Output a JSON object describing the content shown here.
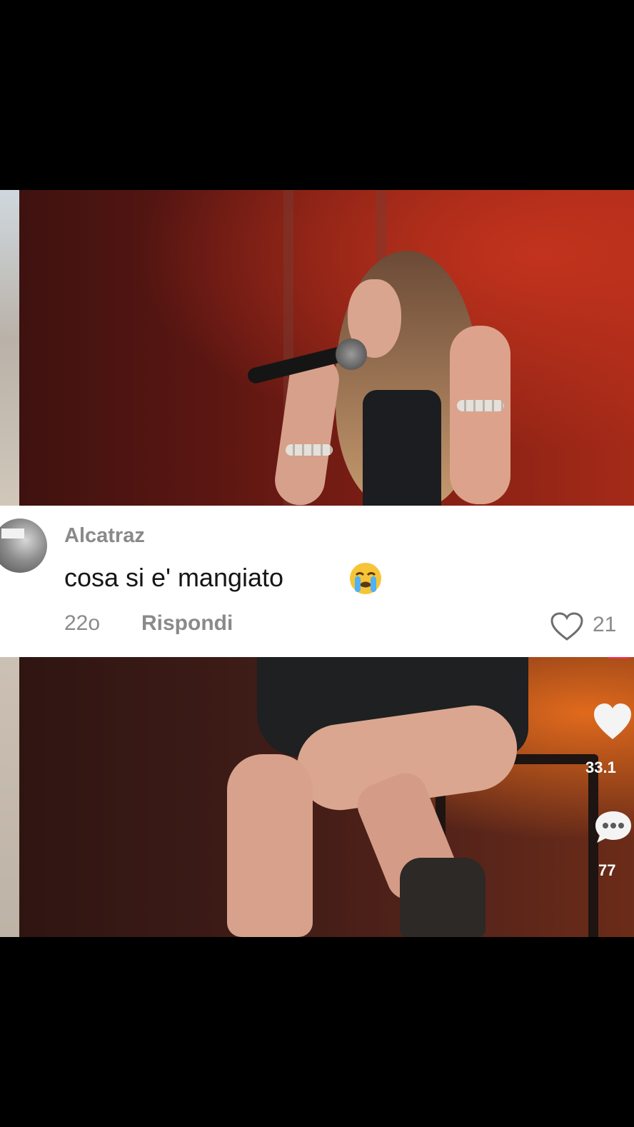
{
  "comment": {
    "username": "Alcatraz",
    "text": "cosa si e' mangiato",
    "emoji": "loudly-crying-face",
    "time": "22o",
    "reply_label": "Rispondi",
    "like_count": "21"
  },
  "side_actions": {
    "likes": "33.1",
    "comments": "77"
  },
  "colors": {
    "background": "#000000",
    "card": "#ffffff",
    "meta_text": "#8a8a8a",
    "accent": "#fe2c55"
  }
}
